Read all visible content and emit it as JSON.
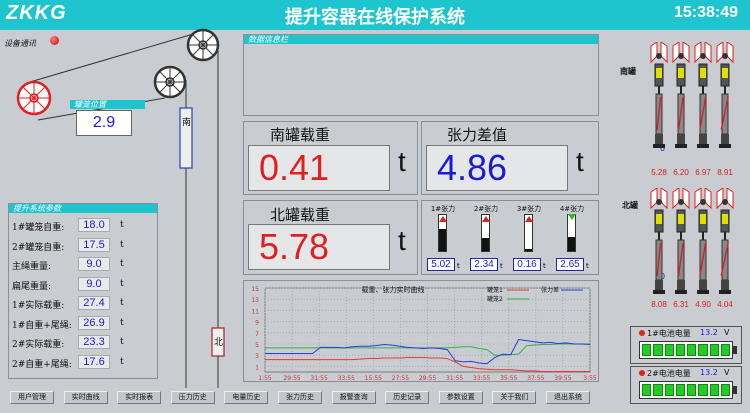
{
  "header": {
    "logo": "ZKKG",
    "title": "提升容器在线保护系统",
    "clock": "15:38:49"
  },
  "comm": {
    "label": "设备通讯"
  },
  "cage_position": {
    "title": "罐笼位置",
    "value": "2.9"
  },
  "shaft_labels": {
    "south": "南",
    "north": "北"
  },
  "data_info": {
    "title": "数据信息栏"
  },
  "south_load": {
    "label": "南罐载重",
    "value": "0.41",
    "unit": "t"
  },
  "tension_diff": {
    "label": "张力差值",
    "value": "4.86",
    "unit": "t"
  },
  "north_load": {
    "label": "北罐载重",
    "value": "5.78",
    "unit": "t"
  },
  "params": {
    "title": "提升系统参数",
    "rows": [
      {
        "label": "1#罐笼自重:",
        "value": "18.0",
        "unit": "t"
      },
      {
        "label": "2#罐笼自重:",
        "value": "17.5",
        "unit": "t"
      },
      {
        "label": "主绳重量:",
        "value": "9.0",
        "unit": "t"
      },
      {
        "label": "扁尾重量:",
        "value": "9.0",
        "unit": "t"
      },
      {
        "label": "1#实际载重:",
        "value": "27.4",
        "unit": "t"
      },
      {
        "label": "1#自重+尾绳:",
        "value": "26.9",
        "unit": "t"
      },
      {
        "label": "2#实际载重:",
        "value": "23.3",
        "unit": "t"
      },
      {
        "label": "2#自重+尾绳:",
        "value": "17.6",
        "unit": "t"
      }
    ]
  },
  "tensions": {
    "items": [
      {
        "label": "1#张力",
        "value": "5.02",
        "level": 0.6
      },
      {
        "label": "2#张力",
        "value": "2.34",
        "level": 0.35
      },
      {
        "label": "3#张力",
        "value": "0.16",
        "level": 0.05
      },
      {
        "label": "4#张力",
        "value": "2.65",
        "level": 0.4
      }
    ]
  },
  "chart_data": {
    "type": "line",
    "title": "载重、张力实时曲线",
    "legend": [
      "罐笼1",
      "罐笼2",
      "张力差"
    ],
    "series": [
      {
        "name": "罐笼1",
        "color": "#e23a3a",
        "values": [
          2.2,
          2.2,
          2.2,
          2.2,
          2.2,
          2.2,
          2.2,
          2.2,
          2.2,
          2.2,
          2.2,
          2.2,
          2.3,
          2.4,
          2.4,
          2.5,
          2.5,
          2.5,
          2.6,
          2.6,
          2.6,
          2.5,
          2.5,
          2.4,
          1.8,
          1.0,
          0.8,
          0.6,
          0.5,
          0.4,
          0.4,
          0.4,
          0.3,
          0.2,
          0.2,
          0.1,
          0.1,
          0.1,
          0.1,
          0.1,
          0.1,
          0.1
        ]
      },
      {
        "name": "罐笼2",
        "color": "#2fb24a",
        "values": [
          4.3,
          4.3,
          4.3,
          4.3,
          4.3,
          4.3,
          4.3,
          4.3,
          4.3,
          4.3,
          4.3,
          4.3,
          4.3,
          4.3,
          4.3,
          4.3,
          4.3,
          4.3,
          4.3,
          4.3,
          4.3,
          4.3,
          4.3,
          4.3,
          4.4,
          4.5,
          4.5,
          4.2,
          4.0,
          3.0,
          3.0,
          3.1,
          3.2,
          4.7,
          4.8,
          4.9,
          4.9,
          5.0,
          5.0,
          5.0,
          5.0,
          5.0
        ]
      },
      {
        "name": "张力差",
        "color": "#2a3ad8",
        "values": [
          3.3,
          3.3,
          3.3,
          3.3,
          3.3,
          3.3,
          3.3,
          4.4,
          4.4,
          4.4,
          4.3,
          4.5,
          4.6,
          4.6,
          4.7,
          4.9,
          4.8,
          4.6,
          4.4,
          4.3,
          4.2,
          4.3,
          4.2,
          4.0,
          2.0,
          1.8,
          1.9,
          1.6,
          1.5,
          2.6,
          3.2,
          3.1,
          5.8,
          5.6,
          5.4,
          5.2,
          5.3,
          5.1,
          5.2,
          5.0,
          5.0,
          4.9
        ]
      }
    ],
    "ylim": [
      0,
      15
    ],
    "yticks": [
      "15",
      "13",
      "11",
      "9",
      "7",
      "5",
      "3",
      "1"
    ],
    "xticks": [
      "1:55",
      "29:55",
      "31:55",
      "33:55",
      "15:55",
      "27:55",
      "29:55",
      "31:55",
      "33:55",
      "35:55",
      "37:55",
      "39:55",
      "3:55"
    ]
  },
  "side": {
    "south_label": "南罐",
    "north_label": "北罐",
    "south_zero": "0",
    "north_zero": "0",
    "south_values": [
      "5.28",
      "6.20",
      "6.97",
      "8.91"
    ],
    "north_values": [
      "8.08",
      "6.31",
      "4.90",
      "4.04"
    ]
  },
  "battery": [
    {
      "label": "1#电池电量",
      "value": "13.2",
      "unit": "V"
    },
    {
      "label": "2#电池电量",
      "value": "13.2",
      "unit": "V"
    }
  ],
  "buttons": [
    "用户管理",
    "实时曲线",
    "实时报表",
    "压力历史",
    "电量历史",
    "张力历史",
    "报警查询",
    "历史记录",
    "参数设置",
    "关于我们",
    "退出系统"
  ]
}
